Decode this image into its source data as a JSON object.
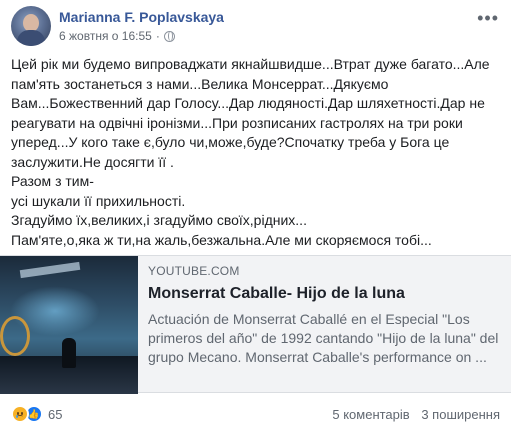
{
  "post": {
    "author": "Marianna F. Poplavskaya",
    "timestamp": "6 жовтня о 16:55",
    "separator": "·",
    "text": "Цей рік ми будемо випроваджати якнайшвидше...Втрат дуже багато...Але пам'ять зостанеться з нами...Велика Монсеррат...Дякуємо Вам...Божественний дар Голосу...Дар людяності.Дар шляхетності.Дар не реагувати на одвічні іронізми...При розписаних гастролях на три роки уперед...У кого таке є,було чи,може,буде?Спочатку треба у Бога це заслужити.Не досягти її .\nРазом з тим-\nусі шукали її прихильності.\nЗгадуймо їх,великих,і згадуймо своїх,рідних...\nПам'яте,о,яка ж ти,на жаль,безжальна.Але ми скоряємося тобі...",
    "more_label": "•••"
  },
  "link_preview": {
    "source": "YOUTUBE.COM",
    "title": "Monserrat Caballe- Hijo de la luna",
    "description": "Actuación de Monserrat Caballé en el Especial \"Los primeros del año\" de 1992 cantando \"Hijo de la luna\" del grupo Mecano. Monserrat Caballe's performance on ..."
  },
  "footer": {
    "reaction_count": "65",
    "reaction_icons": [
      "sad-icon",
      "like-icon"
    ],
    "comments": "5 коментарів",
    "shares": "3 поширення"
  },
  "colors": {
    "author": "#385898",
    "secondary_text": "#606770",
    "card_background": "#f2f3f5",
    "like_blue": "#1877f2",
    "sad_yellow": "#f7b125"
  }
}
